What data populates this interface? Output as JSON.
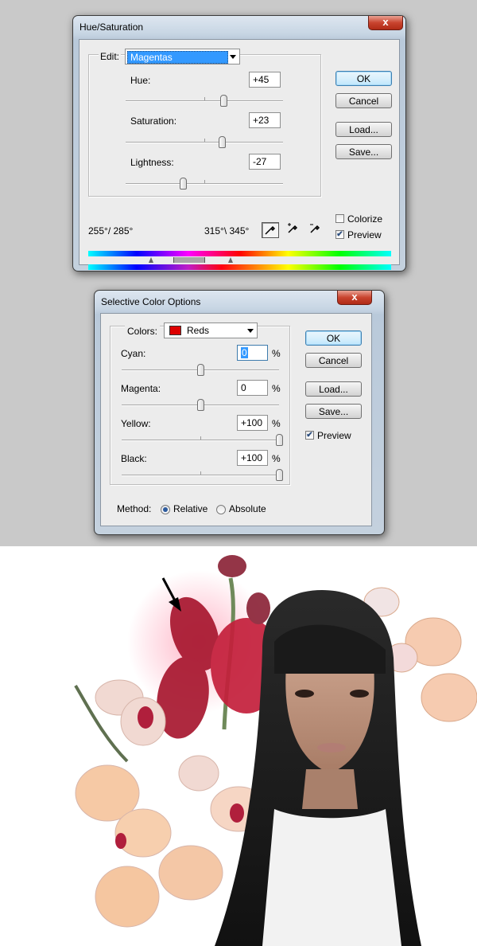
{
  "hue_saturation": {
    "title": "Hue/Saturation",
    "close_glyph": "x",
    "edit_label": "Edit:",
    "edit_value": "Magentas",
    "hue_label": "Hue:",
    "hue_value": "+45",
    "hue_level": 0.625,
    "saturation_label": "Saturation:",
    "saturation_value": "+23",
    "saturation_level": 0.615,
    "lightness_label": "Lightness:",
    "lightness_value": "-27",
    "lightness_level": 0.365,
    "range_left": "255°/ 285°",
    "range_right": "315°\\ 345°",
    "ok": "OK",
    "cancel": "Cancel",
    "load": "Load...",
    "save": "Save...",
    "colorize_label": "Colorize",
    "colorize_checked": false,
    "preview_label": "Preview",
    "preview_checked": true
  },
  "selective_color": {
    "title": "Selective Color Options",
    "close_glyph": "x",
    "colors_label": "Colors:",
    "colors_value": "Reds",
    "colors_swatch": "#dd0000",
    "cyan_label": "Cyan:",
    "cyan_value": "0",
    "cyan_level": 0.5,
    "magenta_label": "Magenta:",
    "magenta_value": "0",
    "magenta_level": 0.5,
    "yellow_label": "Yellow:",
    "yellow_value": "+100",
    "yellow_level": 1.0,
    "black_label": "Black:",
    "black_value": "+100",
    "black_level": 1.0,
    "percent": "%",
    "ok": "OK",
    "cancel": "Cancel",
    "load": "Load...",
    "save": "Save...",
    "preview_label": "Preview",
    "preview_checked": true,
    "method_label": "Method:",
    "relative_label": "Relative",
    "relative_selected": true,
    "absolute_label": "Absolute",
    "absolute_selected": false
  },
  "colors": {
    "accent": "#3399ff",
    "close_red": "#c9442f",
    "background_gray": "#c9c9c9"
  }
}
